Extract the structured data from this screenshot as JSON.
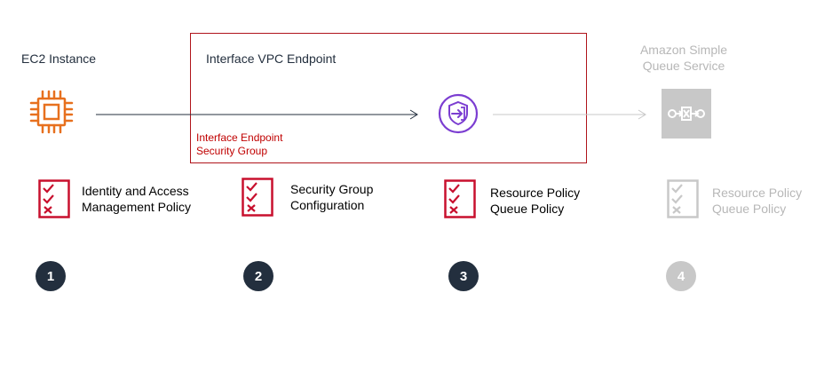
{
  "nodes": {
    "ec2": {
      "label": "EC2 Instance"
    },
    "vpc_endpoint": {
      "label": "Interface VPC Endpoint",
      "sg_label_line1": "Interface Endpoint",
      "sg_label_line2": "Security Group"
    },
    "sqs": {
      "label_line1": "Amazon Simple",
      "label_line2": "Queue Service"
    }
  },
  "policies": [
    {
      "line1": "Identity and Access",
      "line2": "Management Policy"
    },
    {
      "line1": "Security Group",
      "line2": "Configuration"
    },
    {
      "line1": "Resource Policy",
      "line2": "Queue Policy"
    },
    {
      "line1": "Resource Policy",
      "line2": "Queue Policy"
    }
  ],
  "steps": [
    "1",
    "2",
    "3",
    "4"
  ],
  "colors": {
    "ec2_orange": "#e7701e",
    "endpoint_purple": "#7b3dd1",
    "policy_red": "#c8102e",
    "inactive_gray": "#c8c8c8",
    "step_dark": "#232f3e"
  },
  "icons": {
    "ec2": "ec2-instance-icon",
    "endpoint": "vpc-endpoint-shield-icon",
    "sqs": "sqs-queue-icon",
    "checklist": "checklist-icon"
  }
}
